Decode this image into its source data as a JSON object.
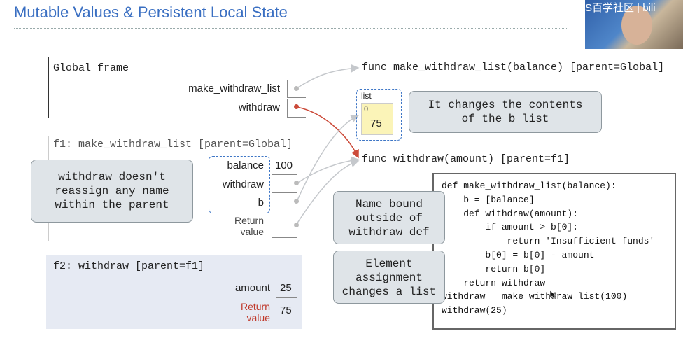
{
  "slide": {
    "title": "Mutable Values & Persistent Local State"
  },
  "webcam": {
    "overlay_text": "S百学社区 | bili"
  },
  "global_frame": {
    "label": "Global frame",
    "bindings": [
      "make_withdraw_list",
      "withdraw"
    ]
  },
  "func_objects": {
    "make_withdraw_list": "func make_withdraw_list(balance) [parent=Global]",
    "withdraw": "func withdraw(amount) [parent=f1]"
  },
  "list_object": {
    "label": "list",
    "index": "0",
    "value": "75"
  },
  "f1_frame": {
    "label": "f1: make_withdraw_list [parent=Global]",
    "balance_name": "balance",
    "balance_value": "100",
    "withdraw_name": "withdraw",
    "b_name": "b",
    "return_line1": "Return",
    "return_line2": "value"
  },
  "f2_frame": {
    "label": "f2: withdraw [parent=f1]",
    "amount_name": "amount",
    "amount_value": "25",
    "return_line1": "Return",
    "return_line2": "value",
    "return_value": "75"
  },
  "callouts": {
    "changes_list": "It changes the contents\nof the b list",
    "no_reassign": "withdraw doesn't\nreassign any name\nwithin the parent",
    "name_bound": "Name bound\noutside of\nwithdraw def",
    "element_assignment": "Element\nassignment\nchanges a list"
  },
  "code": [
    "def make_withdraw_list(balance):",
    "    b = [balance]",
    "    def withdraw(amount):",
    "        if amount > b[0]:",
    "            return 'Insufficient funds'",
    "        b[0] = b[0] - amount",
    "        return b[0]",
    "    return withdraw",
    "",
    "withdraw = make_withdraw_list(100)",
    "withdraw(25)"
  ],
  "colors": {
    "title": "#3a6fc2",
    "return_label": "#c0392b",
    "active_arrow": "#cc4b3a",
    "f2_bg": "#e6eaf3"
  }
}
